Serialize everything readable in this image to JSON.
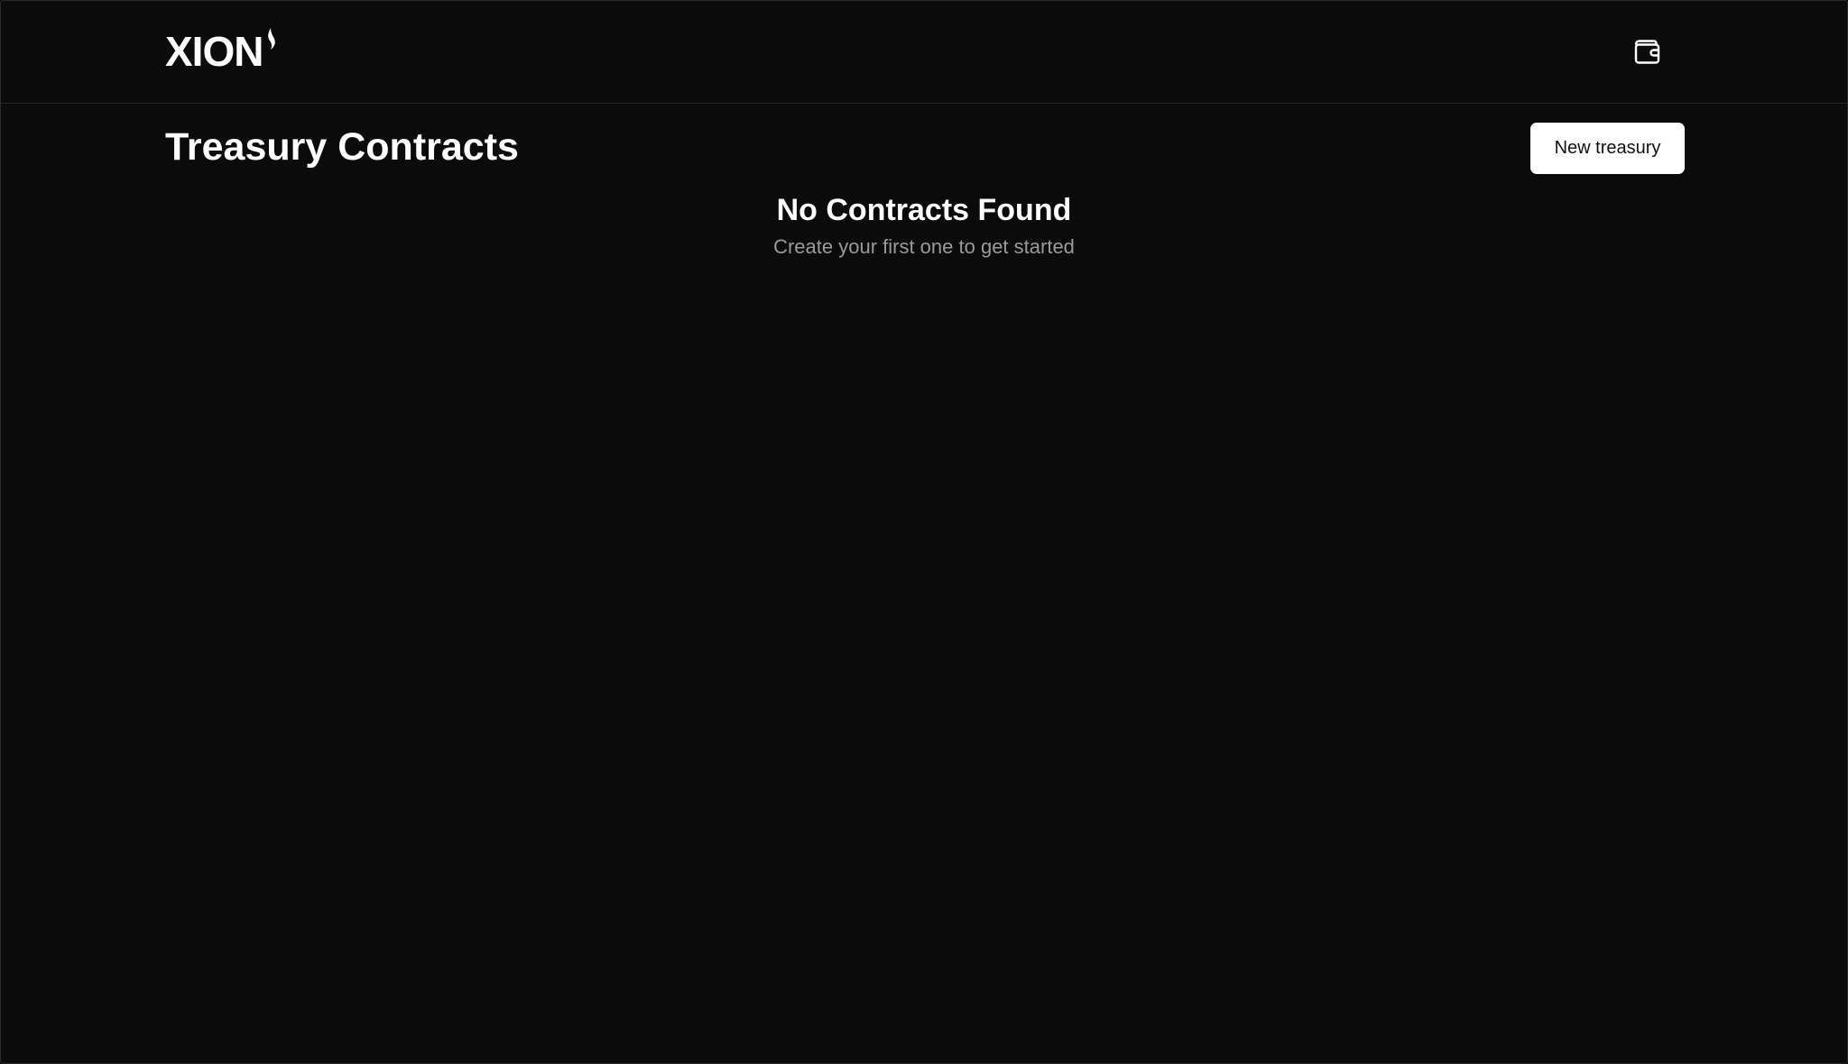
{
  "header": {
    "logo_text": "XION",
    "wallet_icon": "wallet-icon"
  },
  "main": {
    "title": "Treasury Contracts",
    "new_button_label": "New treasury",
    "empty_state": {
      "title": "No Contracts Found",
      "subtitle": "Create your first one to get started"
    }
  },
  "colors": {
    "background": "#0b0b0b",
    "border": "#262626",
    "text_primary": "#ffffff",
    "text_secondary": "#9a9a9a",
    "button_bg": "#ffffff",
    "button_text": "#111111"
  }
}
